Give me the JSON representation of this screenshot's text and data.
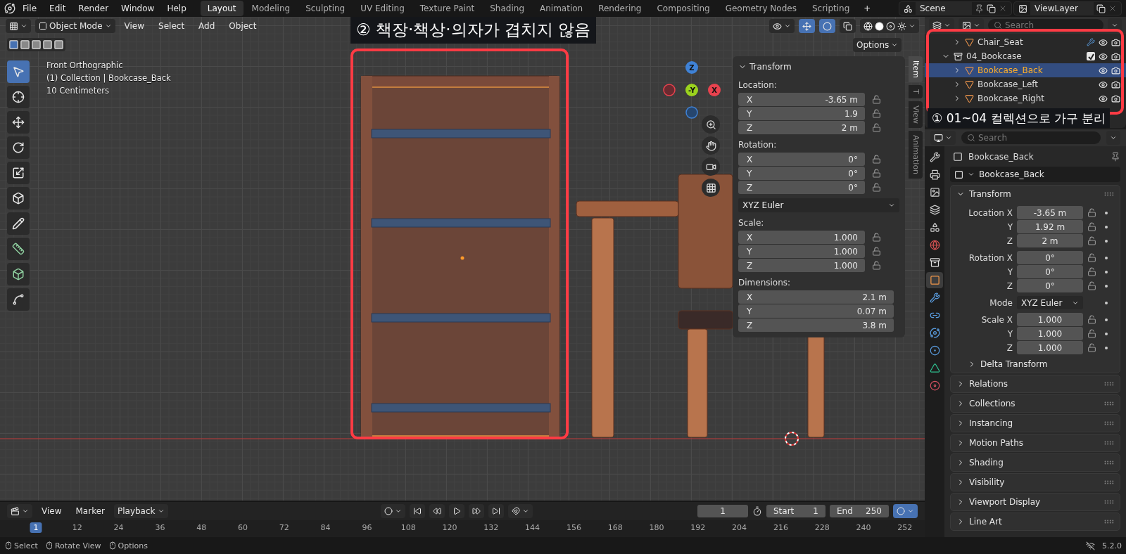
{
  "topbar": {
    "menu": [
      "File",
      "Edit",
      "Render",
      "Window",
      "Help"
    ],
    "workspaces": [
      {
        "label": "Layout",
        "selected": true
      },
      {
        "label": "Modeling",
        "selected": false
      },
      {
        "label": "Sculpting",
        "selected": false
      },
      {
        "label": "UV Editing",
        "selected": false
      },
      {
        "label": "Texture Paint",
        "selected": false
      },
      {
        "label": "Shading",
        "selected": false
      },
      {
        "label": "Animation",
        "selected": false
      },
      {
        "label": "Rendering",
        "selected": false
      },
      {
        "label": "Compositing",
        "selected": false
      },
      {
        "label": "Geometry Nodes",
        "selected": false
      },
      {
        "label": "Scripting",
        "selected": false
      }
    ],
    "add_workspace": "+",
    "scene": "Scene",
    "view_layer": "ViewLayer"
  },
  "viewport": {
    "mode": "Object Mode",
    "menus": [
      "View",
      "Select",
      "Add",
      "Object"
    ],
    "options": "Options",
    "info": [
      "Front Orthographic",
      "(1) Collection | Bookcase_Back",
      "10 Centimeters"
    ],
    "gizmo": {
      "top": "Z",
      "center": "-Y",
      "right": "X"
    },
    "callout": "② 책장·책상·의자가 겹치지 않음"
  },
  "sidebar": {
    "tabs": [
      {
        "label": "Item",
        "selected": true
      },
      {
        "label": "T",
        "selected": false
      },
      {
        "label": "View",
        "selected": false
      },
      {
        "label": "Animation",
        "selected": false
      }
    ],
    "panel": "Transform",
    "groups": [
      {
        "kind": "fields",
        "title": "Location:",
        "locks": true,
        "rows": [
          {
            "axis": "X",
            "value": "-3.65 m"
          },
          {
            "axis": "Y",
            "value": "1.9"
          },
          {
            "axis": "Z",
            "value": "2 m"
          }
        ]
      },
      {
        "kind": "fields",
        "title": "Rotation:",
        "locks": true,
        "rows": [
          {
            "axis": "X",
            "value": "0°"
          },
          {
            "axis": "Y",
            "value": "0°"
          },
          {
            "axis": "Z",
            "value": "0°"
          }
        ]
      },
      {
        "kind": "dropdown",
        "value": "XYZ Euler"
      },
      {
        "kind": "fields",
        "title": "Scale:",
        "locks": true,
        "rows": [
          {
            "axis": "X",
            "value": "1.000"
          },
          {
            "axis": "Y",
            "value": "1.000"
          },
          {
            "axis": "Z",
            "value": "1.000"
          }
        ]
      },
      {
        "kind": "fields",
        "title": "Dimensions:",
        "locks": false,
        "rows": [
          {
            "axis": "X",
            "value": "2.1 m"
          },
          {
            "axis": "Y",
            "value": "0.07 m"
          },
          {
            "axis": "Z",
            "value": "3.8 m"
          }
        ]
      }
    ]
  },
  "outliner": {
    "search": {
      "placeholder": "Search"
    },
    "items": [
      {
        "kind": "mesh",
        "name": "Chair_Seat",
        "selected": false,
        "expanded": false,
        "modifier": true
      },
      {
        "kind": "collection",
        "name": "04_Bookcase",
        "selected": false,
        "expanded": true,
        "checked": true,
        "children": [
          {
            "kind": "mesh",
            "name": "Bookcase_Back",
            "selected": true,
            "expanded": false,
            "modifier": false
          },
          {
            "kind": "mesh",
            "name": "Bookcase_Left",
            "selected": false,
            "expanded": false,
            "modifier": false
          },
          {
            "kind": "mesh",
            "name": "Bookcase_Right",
            "selected": false,
            "expanded": false,
            "modifier": false
          }
        ]
      }
    ],
    "callout": "① 01~04 컬렉션으로 가구 분리"
  },
  "properties": {
    "search": {
      "placeholder": "Search"
    },
    "tabs": [
      {
        "selected": false
      },
      {
        "selected": false
      },
      {
        "selected": false
      },
      {
        "selected": false
      },
      {
        "selected": false
      },
      {
        "selected": false
      },
      {
        "selected": false
      },
      {
        "selected": true
      },
      {
        "selected": false
      },
      {
        "selected": false
      },
      {
        "selected": false
      },
      {
        "selected": false
      },
      {
        "selected": false
      },
      {
        "selected": false
      }
    ],
    "object": "Bookcase_Back",
    "datablock": "Bookcase_Back",
    "transform": {
      "title": "Transform",
      "expanded": true,
      "groups": [
        [
          {
            "kind": "number",
            "label": "Location X",
            "value": "-3.65 m"
          },
          {
            "kind": "number",
            "label": "Y",
            "value": "1.92 m"
          },
          {
            "kind": "number",
            "label": "Z",
            "value": "2 m"
          }
        ],
        [
          {
            "kind": "number",
            "label": "Rotation X",
            "value": "0°"
          },
          {
            "kind": "number",
            "label": "Y",
            "value": "0°"
          },
          {
            "kind": "number",
            "label": "Z",
            "value": "0°"
          }
        ],
        [
          {
            "kind": "dropdown",
            "label": "Mode",
            "value": "XYZ Euler"
          }
        ],
        [
          {
            "kind": "number",
            "label": "Scale X",
            "value": "1.000"
          },
          {
            "kind": "number",
            "label": "Y",
            "value": "1.000"
          },
          {
            "kind": "number",
            "label": "Z",
            "value": "1.000"
          }
        ]
      ],
      "subpanel": "Delta Transform"
    },
    "panels": [
      "Relations",
      "Collections",
      "Instancing",
      "Motion Paths",
      "Shading",
      "Visibility",
      "Viewport Display",
      "Line Art"
    ]
  },
  "timeline": {
    "menus": [
      "View",
      "Marker"
    ],
    "playback": "Playback",
    "frame": "1",
    "start_label": "Start",
    "start": "1",
    "end_label": "End",
    "end": "250",
    "ticks": [
      {
        "label": "1",
        "selected": true
      },
      {
        "label": "12",
        "selected": false
      },
      {
        "label": "24",
        "selected": false
      },
      {
        "label": "36",
        "selected": false
      },
      {
        "label": "48",
        "selected": false
      },
      {
        "label": "60",
        "selected": false
      },
      {
        "label": "72",
        "selected": false
      },
      {
        "label": "84",
        "selected": false
      },
      {
        "label": "96",
        "selected": false
      },
      {
        "label": "108",
        "selected": false
      },
      {
        "label": "120",
        "selected": false
      },
      {
        "label": "132",
        "selected": false
      },
      {
        "label": "144",
        "selected": false
      },
      {
        "label": "156",
        "selected": false
      },
      {
        "label": "168",
        "selected": false
      },
      {
        "label": "180",
        "selected": false
      },
      {
        "label": "192",
        "selected": false
      },
      {
        "label": "204",
        "selected": false
      },
      {
        "label": "216",
        "selected": false
      },
      {
        "label": "228",
        "selected": false
      },
      {
        "label": "240",
        "selected": false
      },
      {
        "label": "252",
        "selected": false
      }
    ]
  },
  "status_bar": {
    "hints": [
      "Select",
      "Rotate View",
      "Options"
    ],
    "version": "5.2.0"
  }
}
